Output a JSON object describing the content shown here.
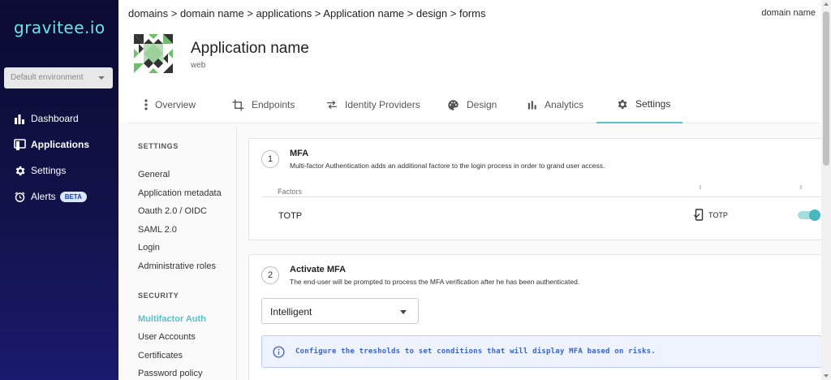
{
  "sidebar": {
    "logo": "gravitee.io",
    "environment": "Default environment",
    "items": [
      {
        "label": "Dashboard",
        "icon": "bar-chart-icon"
      },
      {
        "label": "Applications",
        "icon": "applications-icon"
      },
      {
        "label": "Settings",
        "icon": "gear-icon"
      },
      {
        "label": "Alerts",
        "icon": "alarm-clock-icon",
        "badge": "BETA"
      }
    ]
  },
  "header": {
    "breadcrumb": "domains > domain name > applications > Application name > design > forms",
    "domain": "domain name",
    "app_title": "Application name",
    "app_type": "web"
  },
  "tabs": [
    {
      "label": "Overview",
      "icon": "more-vertical-icon"
    },
    {
      "label": "Endpoints",
      "icon": "crop-icon"
    },
    {
      "label": "Identity Providers",
      "icon": "swap-icon"
    },
    {
      "label": "Design",
      "icon": "palette-icon"
    },
    {
      "label": "Analytics",
      "icon": "bar-chart-icon"
    },
    {
      "label": "Settings",
      "icon": "gear-icon",
      "active": true
    }
  ],
  "settings_menu": {
    "settings_heading": "SETTINGS",
    "settings_items": [
      "General",
      "Application metadata",
      "Oauth 2.0 / OIDC",
      "SAML 2.0",
      "Login",
      "Administrative roles"
    ],
    "security_heading": "SECURITY",
    "security_items": [
      "Multifactor Auth",
      "User Accounts",
      "Certificates",
      "Password policy"
    ],
    "active_item": "Multifactor Auth"
  },
  "mfa_card": {
    "step": "1",
    "title": "MFA",
    "description": "Multi-factor Authentication adds an additional factore to the login process in order to grand user access.",
    "column_factors": "Factors",
    "row_name": "TOTP",
    "row_type": "TOTP",
    "enabled": true
  },
  "activate_card": {
    "step": "2",
    "title": "Activate MFA",
    "description": "The end-user will be prompted to process the MFA verification after he has been authenticated.",
    "select_value": "Intelligent",
    "info": "Configure the tresholds to set conditions that will display MFA based on risks."
  },
  "colors": {
    "accent": "#5cbfc9",
    "sidebar": "#0b0b33",
    "info_text": "#3a62c7"
  }
}
